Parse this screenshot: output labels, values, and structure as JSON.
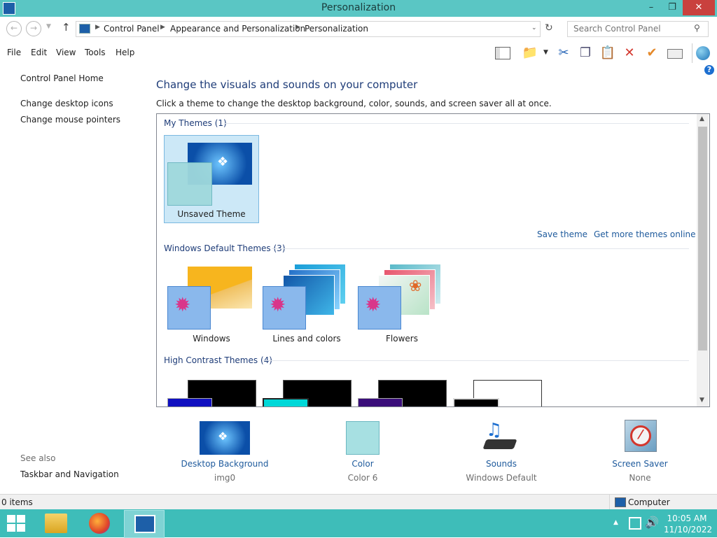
{
  "window": {
    "title": "Personalization",
    "minimize": "–",
    "maximize": "❐",
    "close": "✕"
  },
  "address": {
    "breadcrumb": [
      "Control Panel",
      "Appearance and Personalization",
      "Personalization"
    ],
    "search_placeholder": "Search Control Panel"
  },
  "menu": [
    "File",
    "Edit",
    "View",
    "Tools",
    "Help"
  ],
  "sidebar": {
    "home": "Control Panel Home",
    "links": [
      "Change desktop icons",
      "Change mouse pointers"
    ],
    "see_also_title": "See also",
    "see_also_links": [
      "Taskbar and Navigation"
    ]
  },
  "main": {
    "heading": "Change the visuals and sounds on your computer",
    "description": "Click a theme to change the desktop background, color, sounds, and screen saver all at once.",
    "my_themes": {
      "title": "My Themes (1)",
      "items": [
        "Unsaved Theme"
      ]
    },
    "save_theme": "Save theme",
    "get_more": "Get more themes online",
    "default_themes": {
      "title": "Windows Default Themes (3)",
      "items": [
        "Windows",
        "Lines and colors",
        "Flowers"
      ]
    },
    "high_contrast": {
      "title": "High Contrast Themes (4)"
    }
  },
  "bottom": [
    {
      "label": "Desktop Background",
      "value": "img0"
    },
    {
      "label": "Color",
      "value": "Color 6"
    },
    {
      "label": "Sounds",
      "value": "Windows Default"
    },
    {
      "label": "Screen Saver",
      "value": "None"
    }
  ],
  "status": {
    "items": "0 items",
    "computer": "Computer"
  },
  "taskbar": {
    "time": "10:05 AM",
    "date": "11/10/2022"
  },
  "colors": {
    "titlebar": "#5ac6c4",
    "taskbar": "#3ebdb9",
    "link": "#1e5a9c",
    "close": "#c9413e"
  }
}
